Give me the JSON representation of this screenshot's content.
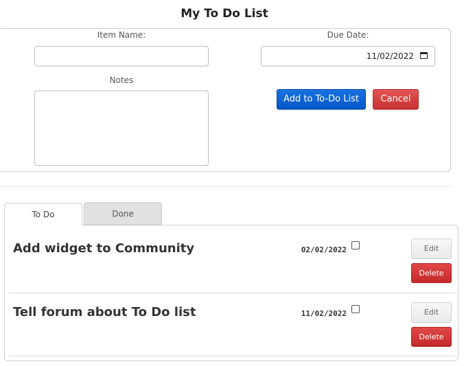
{
  "page": {
    "title": "My To Do List"
  },
  "form": {
    "item_name_label": "Item Name:",
    "item_name_value": "",
    "due_date_label": "Due Date:",
    "due_date_value": "11/02/2022",
    "notes_label": "Notes",
    "notes_value": "",
    "add_label": "Add to To-Do List",
    "cancel_label": "Cancel"
  },
  "tabs": [
    {
      "label": "To Do",
      "active": true
    },
    {
      "label": "Done",
      "active": false
    }
  ],
  "items": [
    {
      "title": "Add widget to Community",
      "date": "02/02/2022",
      "done": false,
      "edit_label": "Edit",
      "delete_label": "Delete"
    },
    {
      "title": "Tell forum about To Do list",
      "date": "11/02/2022",
      "done": false,
      "edit_label": "Edit",
      "delete_label": "Delete"
    }
  ],
  "icons": {
    "date_picker": "calendar-icon"
  },
  "colors": {
    "primary": "#0a63d6",
    "danger": "#d23b3b",
    "tab_inactive": "#e1e1e1"
  }
}
